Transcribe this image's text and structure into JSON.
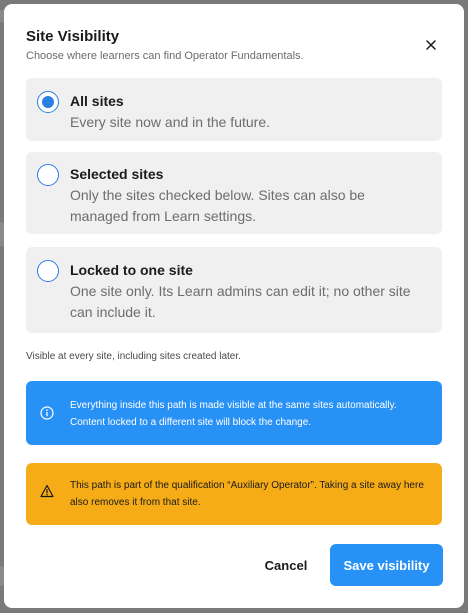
{
  "modal": {
    "title": "Site Visibility",
    "subtitle": "Choose where learners can find Operator Fundamentals."
  },
  "options": [
    {
      "label": "All sites",
      "description": "Every site now and in the future.",
      "selected": true
    },
    {
      "label": "Selected sites",
      "description": "Only the sites checked below. Sites can also be managed from Learn settings.",
      "selected": false
    },
    {
      "label": "Locked to one site",
      "description": "One site only. Its Learn admins can edit it; no other site can include it.",
      "selected": false
    }
  ],
  "helper_text": "Visible at every site, including sites created later.",
  "info_banner": {
    "icon": "info-icon",
    "text": "Everything inside this path is made visible at the same sites automatically. Content locked to a different site will block the change."
  },
  "warning_banner": {
    "icon": "warning-icon",
    "text": "This path is part of the qualification “Auxiliary Operator”. Taking a site away here also removes it from that site."
  },
  "actions": {
    "cancel_label": "Cancel",
    "save_label": "Save visibility"
  },
  "colors": {
    "accent": "#2891f5",
    "radio": "#2b7fe0",
    "warning": "#f6ac16"
  }
}
